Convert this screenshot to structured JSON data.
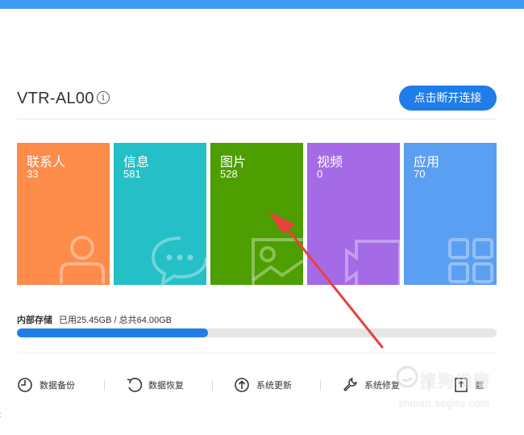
{
  "device": {
    "name": "VTR-AL00",
    "info_icon": "i",
    "disconnect_label": "点击断开连接"
  },
  "categories": [
    {
      "label": "联系人",
      "count": "33",
      "color": "#fd8c4b",
      "icon": "contact-icon"
    },
    {
      "label": "信息",
      "count": "581",
      "color": "#25bfc7",
      "icon": "message-icon"
    },
    {
      "label": "图片",
      "count": "528",
      "color": "#4d9e00",
      "icon": "image-icon"
    },
    {
      "label": "视频",
      "count": "0",
      "color": "#a56ae6",
      "icon": "video-icon"
    },
    {
      "label": "应用",
      "count": "70",
      "color": "#5b9ff3",
      "icon": "apps-icon"
    }
  ],
  "storage": {
    "label": "内部存储",
    "detail": "已用25.45GB / 总共64.00GB",
    "used_fraction": 0.398
  },
  "actions": [
    {
      "label": "数据备份",
      "icon": "backup-icon"
    },
    {
      "label": "数据恢复",
      "icon": "restore-icon"
    },
    {
      "label": "系统更新",
      "icon": "upload-icon"
    },
    {
      "label": "系统修复",
      "icon": "wrench-icon"
    },
    {
      "label": "截",
      "icon": "screenshot-icon"
    }
  ],
  "watermark": {
    "brand": "搜狗指南",
    "url": "zhinan.sogou.com"
  },
  "nav": {
    "back_glyph": "‹"
  },
  "colors": {
    "accent": "#1e7de8",
    "topbar": "#3f9bf2",
    "arrow": "#e8413c"
  }
}
